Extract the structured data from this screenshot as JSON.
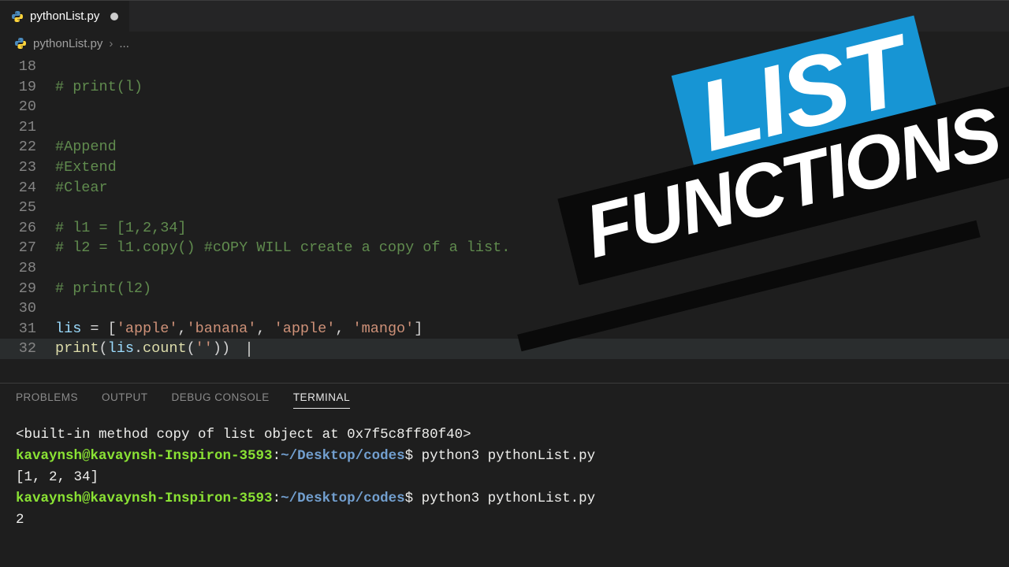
{
  "tab": {
    "filename": "pythonList.py",
    "dirty": true
  },
  "breadcrumb": {
    "filename": "pythonList.py",
    "sep": "›",
    "rest": "..."
  },
  "code_lines": [
    {
      "n": 18,
      "tokens": []
    },
    {
      "n": 19,
      "tokens": [
        {
          "c": "cm",
          "t": "# print(l)"
        }
      ]
    },
    {
      "n": 20,
      "tokens": []
    },
    {
      "n": 21,
      "tokens": []
    },
    {
      "n": 22,
      "tokens": [
        {
          "c": "cm",
          "t": "#Append"
        }
      ]
    },
    {
      "n": 23,
      "tokens": [
        {
          "c": "cm",
          "t": "#Extend"
        }
      ]
    },
    {
      "n": 24,
      "tokens": [
        {
          "c": "cm",
          "t": "#Clear"
        }
      ]
    },
    {
      "n": 25,
      "tokens": []
    },
    {
      "n": 26,
      "tokens": [
        {
          "c": "cm",
          "t": "# l1 = [1,2,34]"
        }
      ]
    },
    {
      "n": 27,
      "tokens": [
        {
          "c": "cm",
          "t": "# l2 = l1.copy() #cOPY WILL create a copy of a list."
        }
      ]
    },
    {
      "n": 28,
      "tokens": []
    },
    {
      "n": 29,
      "tokens": [
        {
          "c": "cm",
          "t": "# print(l2)"
        }
      ]
    },
    {
      "n": 30,
      "tokens": []
    },
    {
      "n": 31,
      "tokens": [
        {
          "c": "var",
          "t": "lis"
        },
        {
          "c": "pw",
          "t": " = ["
        },
        {
          "c": "str",
          "t": "'apple'"
        },
        {
          "c": "pw",
          "t": ","
        },
        {
          "c": "str",
          "t": "'banana'"
        },
        {
          "c": "pw",
          "t": ", "
        },
        {
          "c": "str",
          "t": "'apple'"
        },
        {
          "c": "pw",
          "t": ", "
        },
        {
          "c": "str",
          "t": "'mango'"
        },
        {
          "c": "pw",
          "t": "]"
        }
      ]
    },
    {
      "n": 32,
      "current": true,
      "cursor": true,
      "tokens": [
        {
          "c": "fn",
          "t": "print"
        },
        {
          "c": "pw",
          "t": "("
        },
        {
          "c": "var",
          "t": "lis"
        },
        {
          "c": "pw",
          "t": "."
        },
        {
          "c": "fn",
          "t": "count"
        },
        {
          "c": "pw",
          "t": "("
        },
        {
          "c": "str",
          "t": "''"
        },
        {
          "c": "pw",
          "t": "))"
        }
      ]
    }
  ],
  "panel_tabs": {
    "problems": "PROBLEMS",
    "output": "OUTPUT",
    "debug": "DEBUG CONSOLE",
    "terminal": "TERMINAL"
  },
  "terminal_lines": [
    {
      "segs": [
        {
          "c": "term-plain",
          "t": "<built-in method copy of list object at 0x7f5c8ff80f40>"
        }
      ]
    },
    {
      "segs": [
        {
          "c": "term-user",
          "t": "kavaynsh@kavaynsh-Inspiron-3593"
        },
        {
          "c": "term-plain",
          "t": ":"
        },
        {
          "c": "term-path",
          "t": "~/Desktop/codes"
        },
        {
          "c": "term-plain",
          "t": "$ python3 pythonList.py"
        }
      ]
    },
    {
      "segs": [
        {
          "c": "term-plain",
          "t": "[1, 2, 34]"
        }
      ]
    },
    {
      "segs": [
        {
          "c": "term-user",
          "t": "kavaynsh@kavaynsh-Inspiron-3593"
        },
        {
          "c": "term-plain",
          "t": ":"
        },
        {
          "c": "term-path",
          "t": "~/Desktop/codes"
        },
        {
          "c": "term-plain",
          "t": "$ python3 pythonList.py"
        }
      ]
    },
    {
      "segs": [
        {
          "c": "term-plain",
          "t": "2"
        }
      ]
    }
  ],
  "stickers": {
    "top": "LIST",
    "bottom": "FUNCTIONS"
  }
}
